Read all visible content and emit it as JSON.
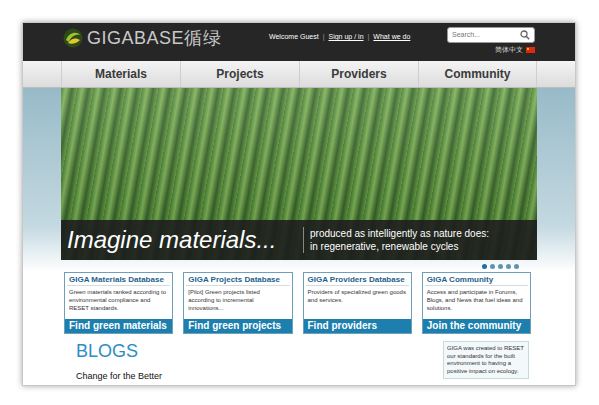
{
  "header": {
    "logo": "GIGABASE循绿",
    "welcome": "Welcome Guest",
    "separator": "|",
    "links": [
      "Sign up / in",
      "What we do"
    ],
    "search": {
      "placeholder": "Search..."
    },
    "language": "简体中文"
  },
  "nav": [
    {
      "label": "Materials",
      "selected": false
    },
    {
      "label": "Projects",
      "selected": false
    },
    {
      "label": "Providers",
      "selected": false
    },
    {
      "label": "Community",
      "selected": false
    }
  ],
  "hero": {
    "title": "Imagine materials...",
    "caption": [
      "produced as intelligently as nature does:",
      "in regenerative, renewable cycles"
    ],
    "dots": [
      {
        "selected": true
      },
      {
        "selected": false
      },
      {
        "selected": false
      },
      {
        "selected": false
      },
      {
        "selected": false
      }
    ]
  },
  "cards": [
    {
      "title": "GIGA Materials Database",
      "description": "Green materials ranked according to environmental compliance and RESET standards.",
      "button": "Find green materials"
    },
    {
      "title": "GIGA Projects Database",
      "description": "[Pilot] Green projects listed according to incremental innovations...",
      "button": "Find green projects"
    },
    {
      "title": "GIGA Providers Database",
      "description": "Providers of specialized green goods and services.",
      "button": "Find providers"
    },
    {
      "title": "GIGA Community",
      "description": "Access and participate in Forums, Blogs, and News that fuel ideas and solutions.",
      "button": "Join the community"
    }
  ],
  "blogs": {
    "heading": "BLOGS",
    "items": [
      "Change for the Better"
    ]
  },
  "about": {
    "text": "GIGA was created to RESET our standards for the built environment to having a positive impact on ecology."
  }
}
